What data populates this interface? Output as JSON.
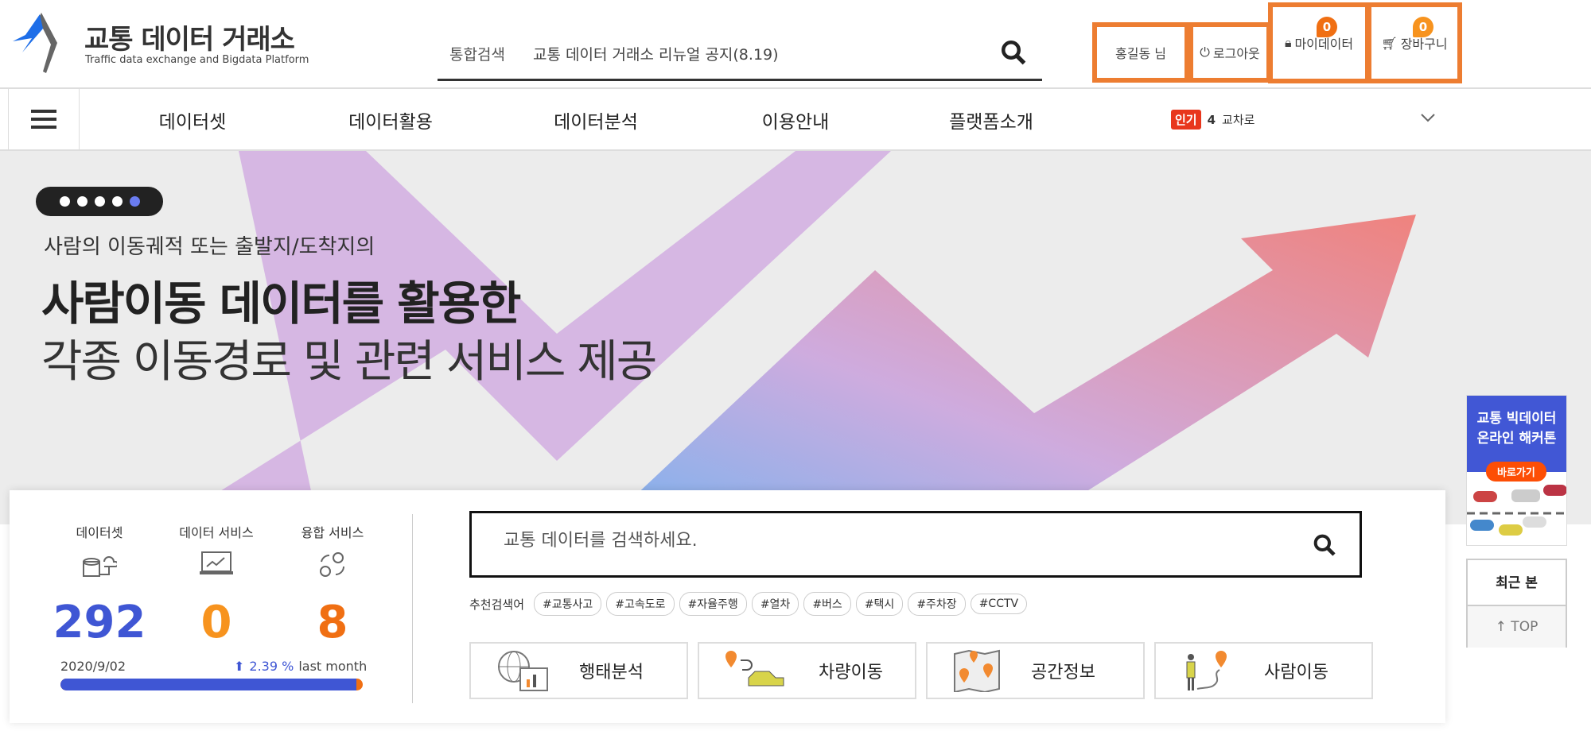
{
  "header": {
    "logo_title": "교통 데이터 거래소",
    "logo_subtitle": "Traffic data exchange and Bigdata Platform",
    "search_label": "통합검색",
    "search_notice": "교통 데이터 거래소 리뉴얼 공지(8.19)",
    "user_name": "홍길동 님",
    "logout": "로그아웃",
    "my_data": "마이데이터",
    "my_data_count": "0",
    "cart": "장바구니",
    "cart_count": "0"
  },
  "nav": {
    "items": [
      "데이터셋",
      "데이터활용",
      "데이터분석",
      "이용안내",
      "플랫폼소개"
    ],
    "popular_badge": "인기",
    "popular_rank": "4",
    "popular_term": "교차로"
  },
  "banner": {
    "slide_count": 5,
    "active_slide": 5,
    "line1": "사람의 이동궤적 또는 출발지/도착지의",
    "line2": "사람이동 데이터를 활용한",
    "line3": "각종 이동경로 및 관련 서비스 제공"
  },
  "stats": {
    "items": [
      {
        "label": "데이터셋",
        "value": "292",
        "color": "#3f56d4"
      },
      {
        "label": "데이터 서비스",
        "value": "0",
        "color": "#f7931e"
      },
      {
        "label": "융합 서비스",
        "value": "8",
        "color": "#f06f13"
      }
    ],
    "date": "2020/9/02",
    "growth": "2.39 %",
    "growth_suffix": "last month",
    "progress_fraction": 0.98
  },
  "search": {
    "placeholder": "교통 데이터를 검색하세요.",
    "tags_label": "추천검색어",
    "tags": [
      "#교통사고",
      "#고속도로",
      "#자율주행",
      "#열차",
      "#버스",
      "#택시",
      "#주차장",
      "#CCTV"
    ]
  },
  "categories": [
    "행태분석",
    "차량이동",
    "공간정보",
    "사람이동"
  ],
  "side": {
    "banner_line1": "교통 빅데이터",
    "banner_line2": "온라인 해커톤",
    "banner_button": "바로가기",
    "recent": "최근 본",
    "top": "↑  TOP"
  }
}
